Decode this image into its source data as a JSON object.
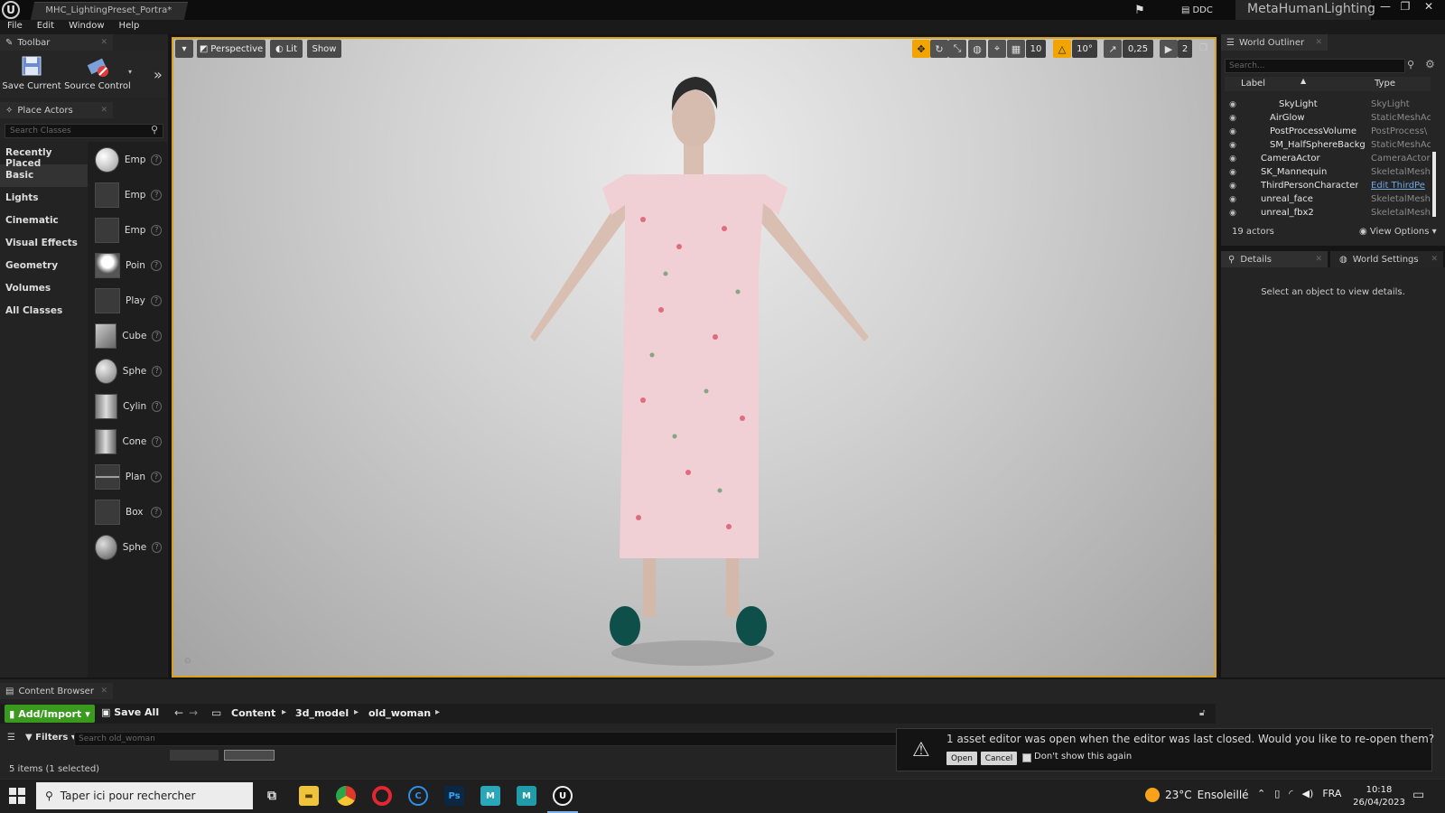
{
  "titlebar": {
    "tab_title": "MHC_LightingPreset_Portra*",
    "ddc_label": "DDC",
    "project_name": "MetaHumanLighting",
    "minimize": "—",
    "restore": "❐",
    "close": "✕"
  },
  "menubar": [
    "File",
    "Edit",
    "Window",
    "Help"
  ],
  "toolbar": {
    "tab_label": "Toolbar",
    "save_current": "Save Current",
    "source_control": "Source Control",
    "expand": "»"
  },
  "place_actors": {
    "tab_label": "Place Actors",
    "search_placeholder": "Search Classes",
    "categories": [
      "Recently Placed",
      "Basic",
      "Lights",
      "Cinematic",
      "Visual Effects",
      "Geometry",
      "Volumes",
      "All Classes"
    ],
    "active_category": "Basic",
    "items": [
      "Emp",
      "Emp",
      "Emp",
      "Poin",
      "Play",
      "Cube",
      "Sphe",
      "Cylin",
      "Cone",
      "Plan",
      "Box",
      "Sphe"
    ]
  },
  "viewport": {
    "perspective": "Perspective",
    "lit": "Lit",
    "show": "Show",
    "grid_snap": "10",
    "rot_snap": "10°",
    "scale_snap": "0,25",
    "cam_speed": "2"
  },
  "world_outliner": {
    "tab_label": "World Outliner",
    "search_placeholder": "Search...",
    "col_label": "Label",
    "col_type": "Type",
    "rows": [
      {
        "label": "SkyLight",
        "type": "SkyLight"
      },
      {
        "label": "AirGlow",
        "type": "StaticMeshAc"
      },
      {
        "label": "PostProcessVolume",
        "type": "PostProcess\\"
      },
      {
        "label": "SM_HalfSphereBackg",
        "type": "StaticMeshAc"
      },
      {
        "label": "CameraActor",
        "type": "CameraActor"
      },
      {
        "label": "SK_Mannequin",
        "type": "SkeletalMesh"
      },
      {
        "label": "ThirdPersonCharacter",
        "type": "Edit ThirdPe"
      },
      {
        "label": "unreal_face",
        "type": "SkeletalMesh"
      },
      {
        "label": "unreal_fbx2",
        "type": "SkeletalMesh"
      }
    ],
    "count": "19 actors",
    "view_options": "View Options"
  },
  "details": {
    "tab_label": "Details",
    "world_settings_tab": "World Settings",
    "empty_message": "Select an object to view details."
  },
  "content_browser": {
    "tab_label": "Content Browser",
    "add_import": "Add/Import",
    "save_all": "Save All",
    "path": [
      "Content",
      "3d_model",
      "old_woman"
    ],
    "filters": "Filters",
    "search_placeholder": "Search old_woman",
    "items_status": "5 items (1 selected)"
  },
  "popup": {
    "message": "1 asset editor was open when the editor was last closed. Would you like to re-open them?",
    "open": "Open",
    "cancel": "Cancel",
    "dont_show": "Don't show this again"
  },
  "taskbar": {
    "search_placeholder": "Taper ici pour rechercher",
    "temperature": "23°C",
    "weather": "Ensoleillé",
    "language": "FRA",
    "time": "10:18",
    "date": "26/04/2023"
  },
  "colors": {
    "viewport_border": "#d8a31a",
    "add_import_green": "#3a9a1e",
    "snap_orange": "#f2a400"
  }
}
